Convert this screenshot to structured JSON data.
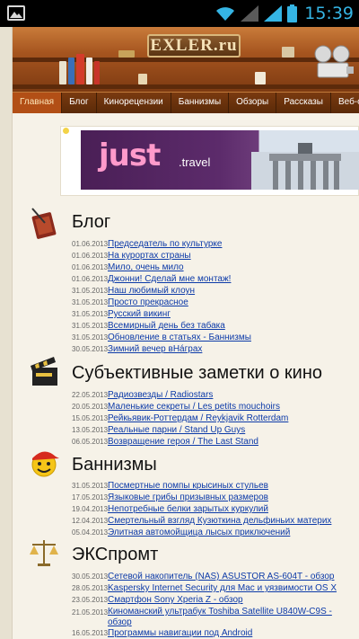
{
  "status_bar": {
    "time": "15:39",
    "icons": [
      "gallery-icon",
      "wifi-icon",
      "signal-icon",
      "signal-icon",
      "battery-icon"
    ]
  },
  "header": {
    "logo": "EXLER.ru"
  },
  "nav": {
    "items": [
      {
        "label": "Главная",
        "active": true
      },
      {
        "label": "Блог"
      },
      {
        "label": "Кинорецензии"
      },
      {
        "label": "Баннизмы"
      },
      {
        "label": "Обзоры"
      },
      {
        "label": "Рассказы"
      },
      {
        "label": "Веб-обзоры"
      }
    ]
  },
  "banner": {
    "word": "just",
    "suffix": ".travel"
  },
  "sections": [
    {
      "title": "Блог",
      "icon": "guestbook-icon",
      "items": [
        {
          "date": "01.06.2013",
          "title": "Председатель по культурке"
        },
        {
          "date": "01.06.2013",
          "title": "На курортах страны"
        },
        {
          "date": "01.06.2013",
          "title": "Мило, очень мило"
        },
        {
          "date": "01.06.2013",
          "title": "Джонни! Сделай мне монтаж!"
        },
        {
          "date": "31.05.2013",
          "title": "Наш любимый клоун"
        },
        {
          "date": "31.05.2013",
          "title": "Просто прекрасное"
        },
        {
          "date": "31.05.2013",
          "title": "Русский викинг"
        },
        {
          "date": "31.05.2013",
          "title": "Всемирный день без табака"
        },
        {
          "date": "31.05.2013",
          "title": "Обновление в статьях - Баннизмы"
        },
        {
          "date": "30.05.2013",
          "title": "Зимний вечер вHáграх"
        }
      ]
    },
    {
      "title": "Субъективные заметки о кино",
      "icon": "clapperboard-icon",
      "items": [
        {
          "date": "22.05.2013",
          "title": "Радиозвезды / Radiostars"
        },
        {
          "date": "20.05.2013",
          "title": "Маленькие секреты / Les petits mouchoirs"
        },
        {
          "date": "15.05.2013",
          "title": "Рейкьявик-Роттердам / Reykjavik Rotterdam"
        },
        {
          "date": "13.05.2013",
          "title": "Реальные парни / Stand Up Guys"
        },
        {
          "date": "06.05.2013",
          "title": "Возвращение героя / The Last Stand"
        }
      ]
    },
    {
      "title": "Баннизмы",
      "icon": "smiley-cap-icon",
      "items": [
        {
          "date": "31.05.2013",
          "title": "Посмертные помпы крысиных стульев"
        },
        {
          "date": "17.05.2013",
          "title": "Языковые грибы призывных размеров"
        },
        {
          "date": "19.04.2013",
          "title": "Непотребные белки зарытых куркулий"
        },
        {
          "date": "12.04.2013",
          "title": "Смертельный взгляд Кузюткина дельфиньих материх"
        },
        {
          "date": "05.04.2013",
          "title": "Элитная автомойщица лысых приключений"
        }
      ]
    },
    {
      "title": "ЭКСпромт",
      "icon": "scales-icon",
      "items": [
        {
          "date": "30.05.2013",
          "title": "Сетевой накопитель (NAS) ASUSTOR AS-604T - обзор"
        },
        {
          "date": "28.05.2013",
          "title": "Kaspersky Internet Security для Mac и уязвимости OS X"
        },
        {
          "date": "23.05.2013",
          "title": "Смартфон Sony Xperia Z - обзор"
        },
        {
          "date": "21.05.2013",
          "title": "Киноманский ультрабук Toshiba Satellite U840W-C9S - обзор"
        },
        {
          "date": "16.05.2013",
          "title": "Программы навигации под Android"
        }
      ]
    }
  ]
}
